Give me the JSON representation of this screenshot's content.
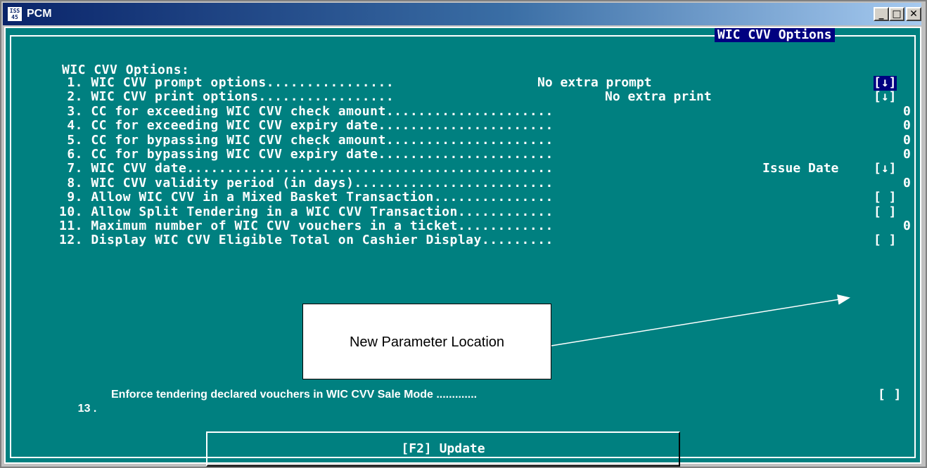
{
  "window": {
    "title": "PCM",
    "icon": "iss-app-icon",
    "icon_text": "ISS 45",
    "controls": {
      "minimize": "_",
      "maximize": "□",
      "close": "✕"
    }
  },
  "screen": {
    "frame_title": "WIC CVV Options",
    "heading": "WIC CVV Options:",
    "rows": [
      {
        "label": " 1. WIC CVV prompt options................",
        "value": "No extra prompt",
        "control": "[↓]"
      },
      {
        "label": " 2. WIC CVV print options.................",
        "value": "No extra print",
        "control": "[↓]"
      },
      {
        "label": " 3. CC for exceeding WIC CVV check amount.....................",
        "value": "0",
        "control": ""
      },
      {
        "label": " 4. CC for exceeding WIC CVV expiry date......................",
        "value": "0",
        "control": ""
      },
      {
        "label": " 5. CC for bypassing WIC CVV check amount.....................",
        "value": "0",
        "control": ""
      },
      {
        "label": " 6. CC for bypassing WIC CVV expiry date......................",
        "value": "0",
        "control": ""
      },
      {
        "label": " 7. WIC CVV date..............................................",
        "value": "Issue Date",
        "control": "[↓]"
      },
      {
        "label": " 8. WIC CVV validity period (in days).........................",
        "value": "0",
        "control": ""
      },
      {
        "label": " 9. Allow WIC CVV in a Mixed Basket Transaction...............",
        "value": "",
        "control": "[ ]"
      },
      {
        "label": "10. Allow Split Tendering in a WIC CVV Transaction............",
        "value": "",
        "control": "[ ]"
      },
      {
        "label": "11. Maximum number of WIC CVV vouchers in a ticket............",
        "value": "0",
        "control": ""
      },
      {
        "label": "12. Display WIC CVV Eligible Total on Cashier Display.........",
        "value": "",
        "control": "[ ]"
      }
    ],
    "row13": {
      "number": "13 .",
      "label": "Enforce tendering declared vouchers in WIC CVV Sale Mode .............",
      "control": "[ ]"
    },
    "update_button": "[F2] Update"
  },
  "annotation": {
    "callout_text": "New Parameter Location"
  },
  "colors": {
    "terminal_bg": "#008080",
    "selection": "#000080",
    "title_start": "#0a246a"
  }
}
